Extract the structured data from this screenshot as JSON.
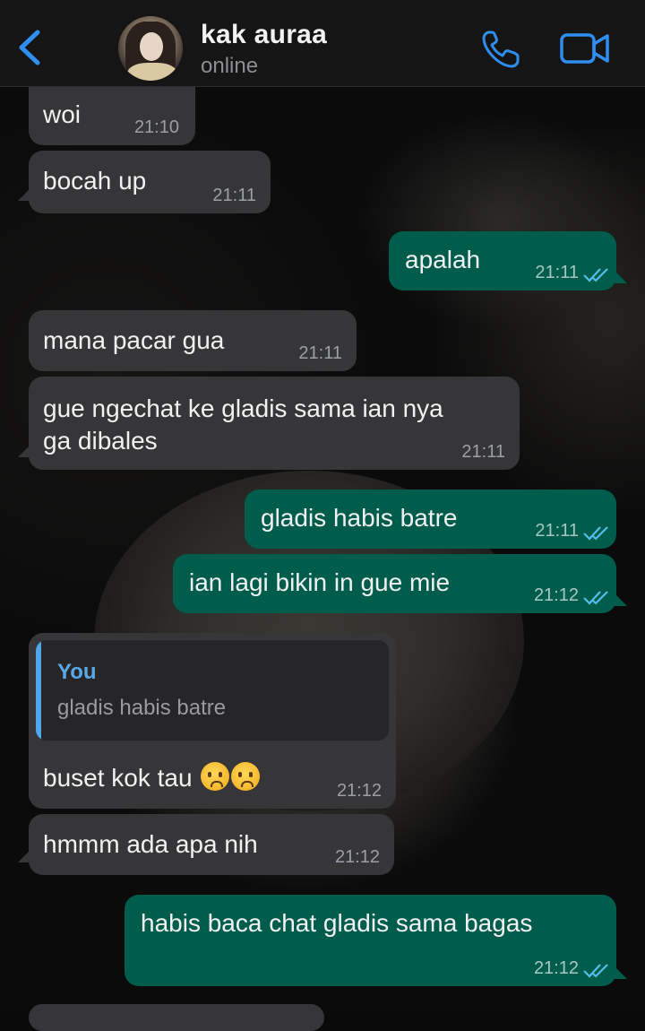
{
  "header": {
    "contact_name": "kak auraa",
    "status": "online",
    "icons": [
      "back-chevron-icon",
      "phone-icon",
      "video-camera-icon"
    ],
    "accent_color": "#2f8ff0"
  },
  "messages": [
    {
      "dir": "in",
      "text": "woi",
      "time": "21:10"
    },
    {
      "dir": "in",
      "text": "bocah up",
      "time": "21:11"
    },
    {
      "dir": "out",
      "text": "apalah",
      "time": "21:11",
      "read": true
    },
    {
      "dir": "in",
      "text": "mana pacar gua",
      "time": "21:11"
    },
    {
      "dir": "in",
      "text_line1": "gue ngechat ke gladis sama ian nya",
      "text_line2": "ga dibales",
      "time": "21:11"
    },
    {
      "dir": "out",
      "text": "gladis habis batre",
      "time": "21:11",
      "read": true
    },
    {
      "dir": "out",
      "text": "ian lagi bikin in gue mie",
      "time": "21:12",
      "read": true
    },
    {
      "dir": "in",
      "quote_author": "You",
      "quote_text": "gladis habis batre",
      "text": "buset kok tau",
      "emoji": [
        "hushed-face",
        "hushed-face"
      ],
      "time": "21:12"
    },
    {
      "dir": "in",
      "text": "hmmm ada apa nih",
      "time": "21:12"
    },
    {
      "dir": "out",
      "text": "habis baca chat gladis sama bagas",
      "time": "21:12",
      "read": true
    }
  ],
  "colors": {
    "incoming_bubble": "#363638",
    "outgoing_bubble": "#005c4b",
    "read_ticks": "#53bdeb"
  }
}
